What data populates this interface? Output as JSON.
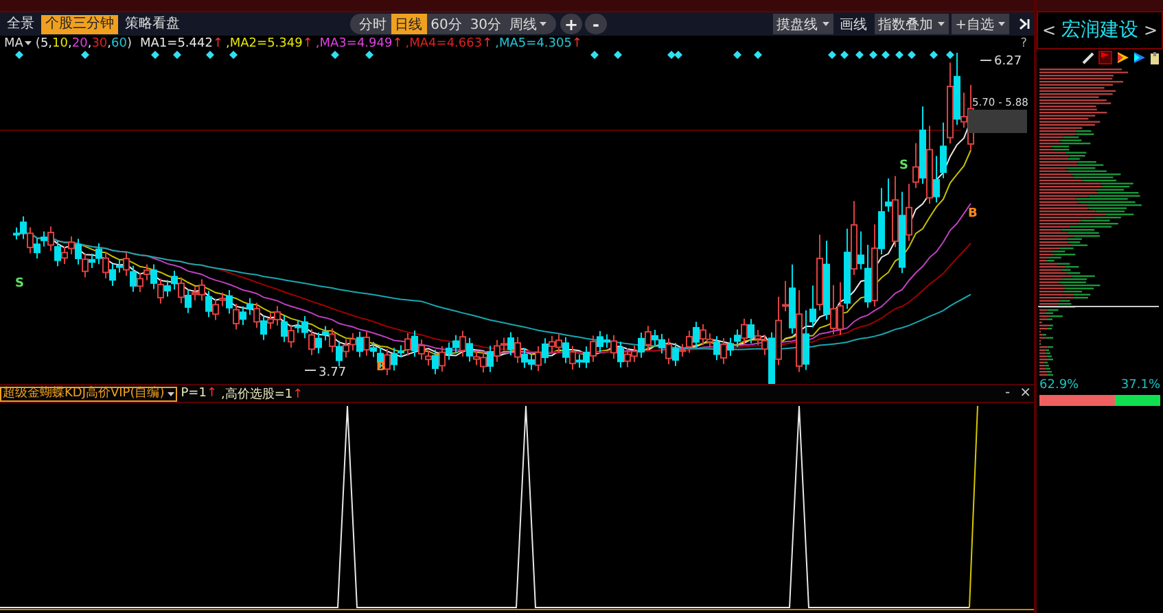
{
  "top_tabs": [
    {
      "label": "全景",
      "selected": false
    },
    {
      "label": "个股三分钟",
      "selected": true
    },
    {
      "label": "策略看盘",
      "selected": false
    }
  ],
  "period_tabs": [
    {
      "label": "分时",
      "selected": false,
      "kind": "plain"
    },
    {
      "label": "日线",
      "selected": true,
      "kind": "plain"
    },
    {
      "label": "60分",
      "selected": false,
      "kind": "plain"
    },
    {
      "label": "30分",
      "selected": false,
      "kind": "plain"
    },
    {
      "label": "周线",
      "selected": false,
      "kind": "dropdown"
    }
  ],
  "zoom_buttons": [
    "+",
    "-"
  ],
  "tools": [
    {
      "label": "摸盘线",
      "kind": "dropdown"
    },
    {
      "label": "画线",
      "kind": "plain"
    },
    {
      "label": "指数叠加",
      "kind": "dropdown"
    },
    {
      "label": "+自选",
      "kind": "dropdown"
    }
  ],
  "stock": {
    "prev": "<",
    "name": "宏润建设",
    "next": ">"
  },
  "ma_legend": {
    "label": "MA",
    "open": "(",
    "close": ")",
    "params": [
      {
        "text": "5",
        "color": "#e8e8e8"
      },
      {
        "text": ",",
        "color": "#e8e8e8"
      },
      {
        "text": "10",
        "color": "#e8e800"
      },
      {
        "text": ",",
        "color": "#e8e8e8"
      },
      {
        "text": "20",
        "color": "#e040e0"
      },
      {
        "text": ",",
        "color": "#e8e8e8"
      },
      {
        "text": "30",
        "color": "#e02020"
      },
      {
        "text": ",",
        "color": "#e8e8e8"
      },
      {
        "text": "60",
        "color": "#20c8d8"
      }
    ],
    "values": [
      {
        "text": "MA1=5.442",
        "arrow": "↑",
        "color": "#e8e8e8"
      },
      {
        "text": ",MA2=5.349",
        "arrow": "↑",
        "color": "#e8e800"
      },
      {
        "text": ",MA3=4.949",
        "arrow": "↑",
        "color": "#e040e0"
      },
      {
        "text": ",MA4=4.663",
        "arrow": "↑",
        "color": "#e02020"
      },
      {
        "text": ",MA5=4.305",
        "arrow": "↑",
        "color": "#20c8d8"
      }
    ]
  },
  "help": "?",
  "price_labels": {
    "high": "6.27",
    "range": "5.70 - 5.88",
    "low": "3.77"
  },
  "signals": [
    {
      "text": "S",
      "kind": "sell"
    },
    {
      "text": "B",
      "kind": "buy"
    },
    {
      "text": "S",
      "kind": "sell"
    },
    {
      "text": "B",
      "kind": "buy"
    }
  ],
  "indicator": {
    "name": "超级金蝴蝶KDJ高价VIP(自编)",
    "params": [
      {
        "text": "P=1",
        "arrow": "↑"
      },
      {
        "text": ",高价选股=1",
        "arrow": "↑"
      }
    ],
    "minimize": "-",
    "close": "×"
  },
  "depth": {
    "buy_pct": "62.9%",
    "sell_pct": "37.1%",
    "level": 0.629
  }
}
